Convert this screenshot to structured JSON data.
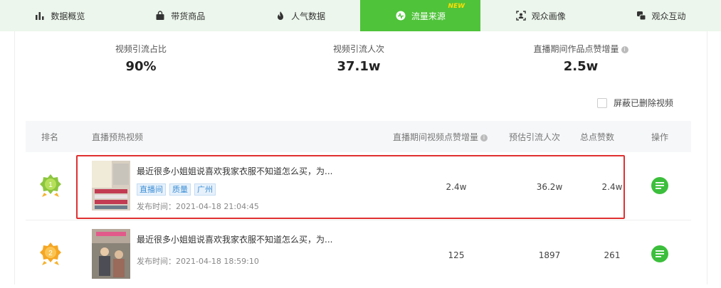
{
  "tabs": [
    {
      "label": "数据概览",
      "icon": "bar-chart-icon"
    },
    {
      "label": "带货商品",
      "icon": "shopping-bag-icon"
    },
    {
      "label": "人气数据",
      "icon": "flame-icon"
    },
    {
      "label": "流量来源",
      "icon": "flow-icon",
      "badge": "NEW",
      "active": true
    },
    {
      "label": "观众画像",
      "icon": "portrait-icon"
    },
    {
      "label": "观众互动",
      "icon": "interaction-icon"
    }
  ],
  "stats": [
    {
      "label": "视频引流占比",
      "value": "90%"
    },
    {
      "label": "视频引流人次",
      "value": "37.1w"
    },
    {
      "label": "直播期间作品点赞增量",
      "value": "2.5w"
    }
  ],
  "filter": {
    "label": "屏蔽已删除视频",
    "checked": false
  },
  "table": {
    "headers": {
      "rank": "排名",
      "video": "直播预热视频",
      "likes_delta": "直播期间视频点赞增量",
      "est_traffic": "预估引流人次",
      "total_likes": "总点赞数",
      "action": "操作"
    },
    "rows": [
      {
        "rank": "1",
        "title": "最近很多小姐姐说喜欢我家衣服不知道怎么买，为...",
        "tags": [
          "直播间",
          "质量",
          "广州"
        ],
        "publish_time": "发布时间：2021-04-18 21:04:45",
        "likes_delta": "2.4w",
        "est_traffic": "36.2w",
        "total_likes": "2.4w"
      },
      {
        "rank": "2",
        "title": "最近很多小姐姐说喜欢我家衣服不知道怎么买，为...",
        "tags": [],
        "publish_time": "发布时间：2021-04-18 18:59:10",
        "likes_delta": "125",
        "est_traffic": "1897",
        "total_likes": "261"
      }
    ]
  },
  "colors": {
    "accent": "#4fc33a",
    "tab_bg": "#ecf6ec",
    "highlight": "#e03030",
    "tag": "#3d8fd6",
    "medal_gold": "#f5b22c",
    "medal_green": "#8cc63f"
  }
}
